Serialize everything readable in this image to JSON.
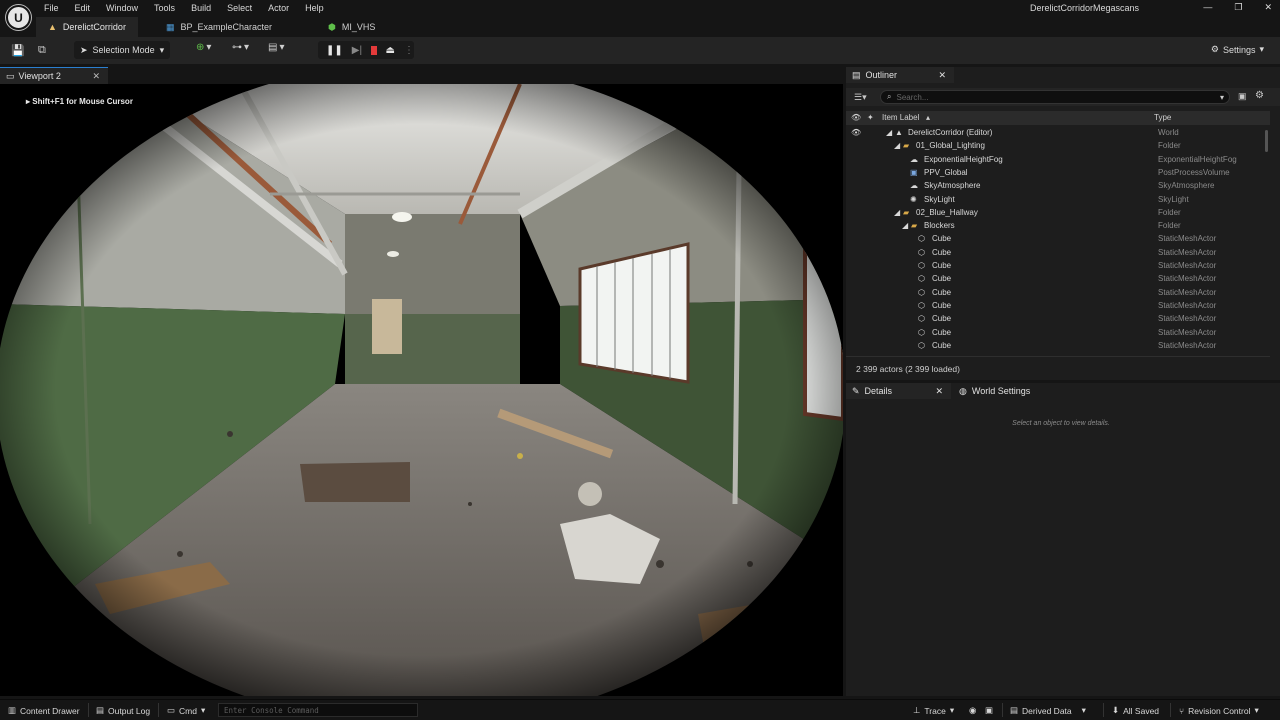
{
  "menu": [
    "File",
    "Edit",
    "Window",
    "Tools",
    "Build",
    "Select",
    "Actor",
    "Help"
  ],
  "project_title": "DerelictCorridorMegascans",
  "window_controls": {
    "minimize": "—",
    "restore": "❐",
    "close": "✕"
  },
  "doc_tabs": [
    {
      "label": "DerelictCorridor",
      "icon": "level-icon"
    },
    {
      "label": "BP_ExampleCharacter",
      "icon": "blueprint-icon"
    },
    {
      "label": "MI_VHS",
      "icon": "material-instance-icon"
    }
  ],
  "toolbar": {
    "selection_mode": "Selection Mode",
    "settings": "Settings"
  },
  "viewport": {
    "tab_label": "Viewport 2",
    "hint": "Shift+F1 for Mouse Cursor"
  },
  "outliner": {
    "tab_label": "Outliner",
    "search_placeholder": "Search...",
    "col_label": "Item Label",
    "col_type": "Type",
    "rows": [
      {
        "label": "DerelictCorridor (Editor)",
        "type": "World"
      },
      {
        "label": "01_Global_Lighting",
        "type": "Folder"
      },
      {
        "label": "ExponentialHeightFog",
        "type": "ExponentialHeightFog"
      },
      {
        "label": "PPV_Global",
        "type": "PostProcessVolume"
      },
      {
        "label": "SkyAtmosphere",
        "type": "SkyAtmosphere"
      },
      {
        "label": "SkyLight",
        "type": "SkyLight"
      },
      {
        "label": "02_Blue_Hallway",
        "type": "Folder"
      },
      {
        "label": "Blockers",
        "type": "Folder"
      },
      {
        "label": "Cube",
        "type": "StaticMeshActor"
      },
      {
        "label": "Cube",
        "type": "StaticMeshActor"
      },
      {
        "label": "Cube",
        "type": "StaticMeshActor"
      },
      {
        "label": "Cube",
        "type": "StaticMeshActor"
      },
      {
        "label": "Cube",
        "type": "StaticMeshActor"
      },
      {
        "label": "Cube",
        "type": "StaticMeshActor"
      },
      {
        "label": "Cube",
        "type": "StaticMeshActor"
      },
      {
        "label": "Cube",
        "type": "StaticMeshActor"
      },
      {
        "label": "Cube",
        "type": "StaticMeshActor"
      }
    ],
    "actor_count": "2 399 actors (2 399 loaded)"
  },
  "details": {
    "tab_label": "Details",
    "world_settings_label": "World Settings",
    "empty_message": "Select an object to view details."
  },
  "statusbar": {
    "content_drawer": "Content Drawer",
    "output_log": "Output Log",
    "cmd": "Cmd",
    "console_placeholder": "Enter Console Command",
    "trace": "Trace",
    "derived_data": "Derived Data",
    "all_saved": "All Saved",
    "revision_control": "Revision Control"
  },
  "colors": {
    "accent_blue": "#2a7fd0",
    "stop_red": "#e43a3a",
    "play_green": "#5fbf4a"
  }
}
